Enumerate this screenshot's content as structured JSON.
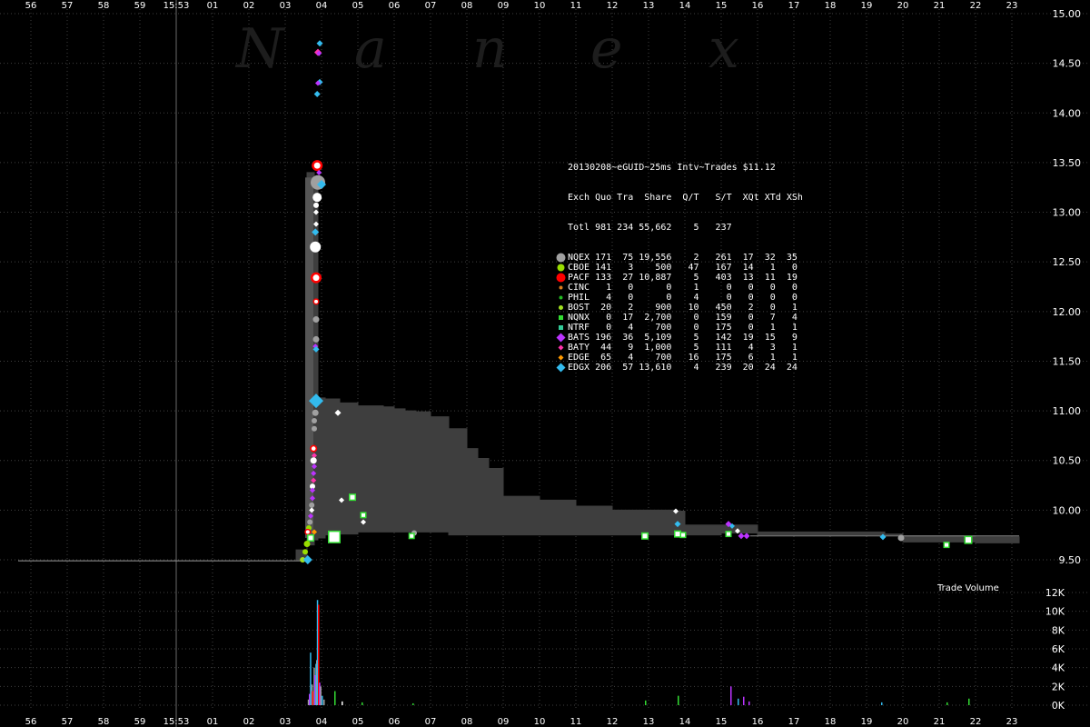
{
  "watermark": [
    "N",
    "a",
    "n",
    "e",
    "x"
  ],
  "x_ticks": [
    {
      "t": -4.0,
      "label": "56"
    },
    {
      "t": -3.0,
      "label": "57"
    },
    {
      "t": -2.0,
      "label": "58"
    },
    {
      "t": -1.0,
      "label": "59"
    },
    {
      "t": 0.0,
      "label": "15:53"
    },
    {
      "t": 1.0,
      "label": "01"
    },
    {
      "t": 2.0,
      "label": "02"
    },
    {
      "t": 3.0,
      "label": "03"
    },
    {
      "t": 4.0,
      "label": "04"
    },
    {
      "t": 5.0,
      "label": "05"
    },
    {
      "t": 6.0,
      "label": "06"
    },
    {
      "t": 7.0,
      "label": "07"
    },
    {
      "t": 8.0,
      "label": "08"
    },
    {
      "t": 9.0,
      "label": "09"
    },
    {
      "t": 10.0,
      "label": "10"
    },
    {
      "t": 11.0,
      "label": "11"
    },
    {
      "t": 12.0,
      "label": "12"
    },
    {
      "t": 13.0,
      "label": "13"
    },
    {
      "t": 14.0,
      "label": "14"
    },
    {
      "t": 15.0,
      "label": "15"
    },
    {
      "t": 16.0,
      "label": "16"
    },
    {
      "t": 17.0,
      "label": "17"
    },
    {
      "t": 18.0,
      "label": "18"
    },
    {
      "t": 19.0,
      "label": "19"
    },
    {
      "t": 20.0,
      "label": "20"
    },
    {
      "t": 21.0,
      "label": "21"
    },
    {
      "t": 22.0,
      "label": "22"
    },
    {
      "t": 23.0,
      "label": "23"
    }
  ],
  "volume_label": "Trade Volume",
  "legend": {
    "title": "20130208~eGUID~25ms Intv~Trades $11.12",
    "header": "Exch Quo Tra  Share  Q/T   S/T  XQt XTd XSh",
    "total": "Totl 981 234 55,662    5   237",
    "rows": [
      {
        "text": "NQEX 171  75 19,556    2   261  17  32  35",
        "color": "#a0a0a0",
        "shape": "circle",
        "size": 5
      },
      {
        "text": "CBOE 141   3    500   47   167  14   1   0",
        "color": "#99dd00",
        "shape": "circle",
        "size": 4
      },
      {
        "text": "PACF 133  27 10,887    5   403  13  11  19",
        "color": "#ff0000",
        "shape": "circle",
        "size": 5
      },
      {
        "text": "CINC   1   0      0    1     0   0   0   0",
        "color": "#d97c1c",
        "shape": "circle",
        "size": 2
      },
      {
        "text": "PHIL   4   0      0    4     0   0   0   0",
        "color": "#22bb22",
        "shape": "circle",
        "size": 2
      },
      {
        "text": "BOST  20   2    900   10   450   2   0   1",
        "color": "#a0e020",
        "shape": "circle",
        "size": 2.5
      },
      {
        "text": "NQNX   0  17  2,700    0   159   0   7   4",
        "color": "#33dd33",
        "shape": "square",
        "size": 2.5
      },
      {
        "text": "NTRF   0   4    700    0   175   0   1   1",
        "color": "#33cc99",
        "shape": "square",
        "size": 2.5
      },
      {
        "text": "BATS 196  36  5,109    5   142  19  15   9",
        "color": "#bb33ff",
        "shape": "diamond",
        "size": 5
      },
      {
        "text": "BATY  44   9  1,000    5   111   4   3   1",
        "color": "#ff33aa",
        "shape": "diamond",
        "size": 3
      },
      {
        "text": "EDGE  65   4    700   16   175   6   1   1",
        "color": "#ff9900",
        "shape": "diamond",
        "size": 3
      },
      {
        "text": "EDGX 206  57 13,610    4   239  20  24  24",
        "color": "#33bbee",
        "shape": "diamond",
        "size": 5
      }
    ]
  },
  "chart_data": {
    "type": "scatter",
    "x_unit": "seconds after 15:53:00 (axis also shows 15:52:56 onward)",
    "xlim": [
      -4.5,
      24.5
    ],
    "price_ylim": [
      9.45,
      15.0
    ],
    "price_ticks": [
      "9.50",
      "10.00",
      "10.50",
      "11.00",
      "11.50",
      "12.00",
      "12.50",
      "13.00",
      "13.50",
      "14.00",
      "14.50",
      "15.00"
    ],
    "volume_ylim": [
      0,
      12000
    ],
    "volume_ticks": [
      "0K",
      "2K",
      "4K",
      "6K",
      "8K",
      "10K",
      "12K"
    ],
    "pre_move_price": 9.49,
    "nbbo_band": [
      {
        "t": 3.3,
        "bid": 9.5,
        "ask": 9.6
      },
      {
        "t": 3.6,
        "bid": 9.65,
        "ask": 13.4
      },
      {
        "t": 3.8,
        "bid": 9.7,
        "ask": 13.3
      },
      {
        "t": 3.9,
        "bid": 9.72,
        "ask": 11.13
      },
      {
        "t": 4.1,
        "bid": 9.75,
        "ask": 11.12
      },
      {
        "t": 4.5,
        "bid": 9.76,
        "ask": 11.08
      },
      {
        "t": 5.0,
        "bid": 9.78,
        "ask": 11.05
      },
      {
        "t": 5.7,
        "bid": 9.78,
        "ask": 11.04
      },
      {
        "t": 6.0,
        "bid": 9.78,
        "ask": 11.02
      },
      {
        "t": 6.3,
        "bid": 9.78,
        "ask": 11.0
      },
      {
        "t": 6.6,
        "bid": 9.78,
        "ask": 10.99
      },
      {
        "t": 7.0,
        "bid": 9.78,
        "ask": 10.94
      },
      {
        "t": 7.5,
        "bid": 9.75,
        "ask": 10.82
      },
      {
        "t": 8.0,
        "bid": 9.75,
        "ask": 10.62
      },
      {
        "t": 8.3,
        "bid": 9.75,
        "ask": 10.52
      },
      {
        "t": 8.6,
        "bid": 9.75,
        "ask": 10.42
      },
      {
        "t": 9.0,
        "bid": 9.75,
        "ask": 10.14
      },
      {
        "t": 10.0,
        "bid": 9.75,
        "ask": 10.1
      },
      {
        "t": 11.0,
        "bid": 9.75,
        "ask": 10.04
      },
      {
        "t": 12.0,
        "bid": 9.75,
        "ask": 10.0
      },
      {
        "t": 13.8,
        "bid": 9.75,
        "ask": 9.99
      },
      {
        "t": 14.0,
        "bid": 9.75,
        "ask": 9.85
      },
      {
        "t": 15.0,
        "bid": 9.77,
        "ask": 9.85
      },
      {
        "t": 16.0,
        "bid": 9.75,
        "ask": 9.78
      },
      {
        "t": 19.5,
        "bid": 9.75,
        "ask": 9.76
      },
      {
        "t": 20.0,
        "bid": 9.68,
        "ask": 9.74
      },
      {
        "t": 22.0,
        "bid": 9.67,
        "ask": 9.73
      },
      {
        "t": 23.2,
        "bid": 9.67,
        "ask": 9.73
      }
    ],
    "quotes": [
      {
        "t": 3.95,
        "p": 14.7,
        "c": "#33bbee",
        "s": "diamond",
        "r": 3.5
      },
      {
        "t": 3.9,
        "p": 14.61,
        "c": "#ff33aa",
        "s": "diamond",
        "r": 4
      },
      {
        "t": 3.93,
        "p": 14.6,
        "c": "#bb33ff",
        "s": "diamond",
        "r": 3
      },
      {
        "t": 3.95,
        "p": 14.31,
        "c": "#33bbee",
        "s": "diamond",
        "r": 3.5
      },
      {
        "t": 3.9,
        "p": 14.3,
        "c": "#bb33ff",
        "s": "diamond",
        "r": 3
      },
      {
        "t": 3.88,
        "p": 14.19,
        "c": "#33bbee",
        "s": "diamond",
        "r": 3.5
      },
      {
        "t": 3.88,
        "p": 13.47,
        "c": "#ff0000",
        "s": "ring",
        "r": 6
      },
      {
        "t": 3.93,
        "p": 13.4,
        "c": "#bb33ff",
        "s": "diamond",
        "r": 3
      },
      {
        "t": 3.9,
        "p": 13.3,
        "c": "#a0a0a0",
        "s": "circle",
        "r": 8
      },
      {
        "t": 4.0,
        "p": 13.28,
        "c": "#33bbee",
        "s": "diamond",
        "r": 5
      },
      {
        "t": 3.88,
        "p": 13.15,
        "c": "#ffffff",
        "s": "circle",
        "r": 5
      },
      {
        "t": 3.85,
        "p": 13.07,
        "c": "#ffffff",
        "s": "circle",
        "r": 3
      },
      {
        "t": 3.85,
        "p": 13.0,
        "c": "#ffffff",
        "s": "diamond",
        "r": 3
      },
      {
        "t": 3.85,
        "p": 12.88,
        "c": "#ffffff",
        "s": "diamond",
        "r": 3
      },
      {
        "t": 3.83,
        "p": 12.8,
        "c": "#33bbee",
        "s": "diamond",
        "r": 4
      },
      {
        "t": 3.83,
        "p": 12.65,
        "c": "#ffffff",
        "s": "ring",
        "r": 6
      },
      {
        "t": 3.85,
        "p": 12.34,
        "c": "#ff0000",
        "s": "ring",
        "r": 6
      },
      {
        "t": 3.85,
        "p": 12.1,
        "c": "#ff0000",
        "s": "ring",
        "r": 3.5
      },
      {
        "t": 3.85,
        "p": 11.92,
        "c": "#a0a0a0",
        "s": "circle",
        "r": 3.5
      },
      {
        "t": 3.85,
        "p": 11.72,
        "c": "#a0a0a0",
        "s": "circle",
        "r": 3.5
      },
      {
        "t": 3.83,
        "p": 11.65,
        "c": "#bb33ff",
        "s": "diamond",
        "r": 3
      },
      {
        "t": 3.85,
        "p": 11.62,
        "c": "#33bbee",
        "s": "diamond",
        "r": 3.5
      },
      {
        "t": 3.85,
        "p": 11.1,
        "c": "#33bbee",
        "s": "diamond",
        "r": 8
      },
      {
        "t": 3.83,
        "p": 10.98,
        "c": "#a0a0a0",
        "s": "circle",
        "r": 3.5
      },
      {
        "t": 3.8,
        "p": 10.9,
        "c": "#a0a0a0",
        "s": "circle",
        "r": 3
      },
      {
        "t": 3.8,
        "p": 10.82,
        "c": "#a0a0a0",
        "s": "circle",
        "r": 3
      },
      {
        "t": 4.45,
        "p": 10.98,
        "c": "#ffffff",
        "s": "diamond",
        "r": 3.5
      },
      {
        "t": 3.78,
        "p": 10.62,
        "c": "#ff0000",
        "s": "ring",
        "r": 4
      },
      {
        "t": 3.8,
        "p": 10.55,
        "c": "#ff33aa",
        "s": "diamond",
        "r": 3
      },
      {
        "t": 3.78,
        "p": 10.5,
        "c": "#ffffff",
        "s": "circle",
        "r": 3.5
      },
      {
        "t": 3.8,
        "p": 10.44,
        "c": "#bb33ff",
        "s": "diamond",
        "r": 3
      },
      {
        "t": 3.78,
        "p": 10.37,
        "c": "#bb33ff",
        "s": "diamond",
        "r": 3
      },
      {
        "t": 3.78,
        "p": 10.3,
        "c": "#ff33aa",
        "s": "diamond",
        "r": 3
      },
      {
        "t": 3.75,
        "p": 10.24,
        "c": "#ffffff",
        "s": "circle",
        "r": 3
      },
      {
        "t": 3.75,
        "p": 10.2,
        "c": "#bb33ff",
        "s": "diamond",
        "r": 3
      },
      {
        "t": 3.75,
        "p": 10.12,
        "c": "#bb33ff",
        "s": "diamond",
        "r": 3
      },
      {
        "t": 3.73,
        "p": 10.05,
        "c": "#a0a0a0",
        "s": "circle",
        "r": 3
      },
      {
        "t": 3.73,
        "p": 10.0,
        "c": "#ffffff",
        "s": "diamond",
        "r": 3
      },
      {
        "t": 3.7,
        "p": 9.94,
        "c": "#bb33ff",
        "s": "diamond",
        "r": 3
      },
      {
        "t": 3.68,
        "p": 9.88,
        "c": "#a0a0a0",
        "s": "circle",
        "r": 3
      },
      {
        "t": 3.65,
        "p": 9.82,
        "c": "#99dd00",
        "s": "circle",
        "r": 3
      },
      {
        "t": 3.62,
        "p": 9.78,
        "c": "#ff0000",
        "s": "ring",
        "r": 3.5
      },
      {
        "t": 3.8,
        "p": 9.78,
        "c": "#ff9900",
        "s": "diamond",
        "r": 3
      },
      {
        "t": 3.7,
        "p": 9.72,
        "c": "#33dd33",
        "s": "square",
        "r": 4
      },
      {
        "t": 3.6,
        "p": 9.66,
        "c": "#99dd00",
        "s": "circle",
        "r": 3.5
      },
      {
        "t": 3.55,
        "p": 9.58,
        "c": "#99dd00",
        "s": "circle",
        "r": 3
      },
      {
        "t": 3.48,
        "p": 9.5,
        "c": "#a0e020",
        "s": "circle",
        "r": 3
      },
      {
        "t": 3.62,
        "p": 9.5,
        "c": "#33bbee",
        "s": "diamond",
        "r": 5
      },
      {
        "t": 4.35,
        "p": 9.73,
        "c": "#33dd33",
        "s": "square",
        "r": 7
      },
      {
        "t": 4.55,
        "p": 10.1,
        "c": "#ffffff",
        "s": "diamond",
        "r": 3
      },
      {
        "t": 4.85,
        "p": 10.13,
        "c": "#33dd33",
        "s": "square",
        "r": 4
      },
      {
        "t": 5.15,
        "p": 9.95,
        "c": "#33dd33",
        "s": "square",
        "r": 3.5
      },
      {
        "t": 5.15,
        "p": 9.88,
        "c": "#ffffff",
        "s": "diamond",
        "r": 3
      },
      {
        "t": 6.55,
        "p": 9.77,
        "c": "#a0a0a0",
        "s": "circle",
        "r": 3
      },
      {
        "t": 6.48,
        "p": 9.74,
        "c": "#33dd33",
        "s": "square",
        "r": 3.5
      },
      {
        "t": 12.9,
        "p": 9.74,
        "c": "#33dd33",
        "s": "square",
        "r": 4
      },
      {
        "t": 13.75,
        "p": 9.99,
        "c": "#ffffff",
        "s": "diamond",
        "r": 3
      },
      {
        "t": 13.8,
        "p": 9.86,
        "c": "#33bbee",
        "s": "diamond",
        "r": 3.5
      },
      {
        "t": 13.8,
        "p": 9.76,
        "c": "#33dd33",
        "s": "square",
        "r": 4
      },
      {
        "t": 13.95,
        "p": 9.75,
        "c": "#33dd33",
        "s": "square",
        "r": 3.5
      },
      {
        "t": 15.2,
        "p": 9.86,
        "c": "#bb33ff",
        "s": "diamond",
        "r": 3.5
      },
      {
        "t": 15.3,
        "p": 9.84,
        "c": "#33bbee",
        "s": "diamond",
        "r": 3
      },
      {
        "t": 15.45,
        "p": 9.79,
        "c": "#ffffff",
        "s": "diamond",
        "r": 3
      },
      {
        "t": 15.2,
        "p": 9.76,
        "c": "#33dd33",
        "s": "square",
        "r": 3.5
      },
      {
        "t": 15.55,
        "p": 9.74,
        "c": "#bb33ff",
        "s": "diamond",
        "r": 3.5
      },
      {
        "t": 15.7,
        "p": 9.74,
        "c": "#bb33ff",
        "s": "diamond",
        "r": 3.5
      },
      {
        "t": 19.45,
        "p": 9.73,
        "c": "#33bbee",
        "s": "diamond",
        "r": 3.5
      },
      {
        "t": 19.95,
        "p": 9.72,
        "c": "#a0a0a0",
        "s": "circle",
        "r": 3.5
      },
      {
        "t": 21.2,
        "p": 9.65,
        "c": "#33dd33",
        "s": "square",
        "r": 3.5
      },
      {
        "t": 21.8,
        "p": 9.7,
        "c": "#33dd33",
        "s": "square",
        "r": 4.5
      }
    ],
    "volume_bars": [
      {
        "t": 3.62,
        "v": 600,
        "c": "#a0a0a0"
      },
      {
        "t": 3.65,
        "v": 1200,
        "c": "#bb33ff"
      },
      {
        "t": 3.68,
        "v": 5600,
        "c": "#33bbee"
      },
      {
        "t": 3.72,
        "v": 2200,
        "c": "#a0a0a0"
      },
      {
        "t": 3.74,
        "v": 1500,
        "c": "#ff0000"
      },
      {
        "t": 3.78,
        "v": 4000,
        "c": "#a0a0a0"
      },
      {
        "t": 3.8,
        "v": 3200,
        "c": "#bb33ff"
      },
      {
        "t": 3.83,
        "v": 4400,
        "c": "#33bbee"
      },
      {
        "t": 3.85,
        "v": 4800,
        "c": "#a0a0a0"
      },
      {
        "t": 3.87,
        "v": 11200,
        "c": "#33bbee"
      },
      {
        "t": 3.9,
        "v": 10700,
        "c": "#ff0000"
      },
      {
        "t": 3.93,
        "v": 2400,
        "c": "#bb33ff"
      },
      {
        "t": 3.96,
        "v": 2000,
        "c": "#a0a0a0"
      },
      {
        "t": 4.0,
        "v": 1000,
        "c": "#33bbee"
      },
      {
        "t": 4.05,
        "v": 600,
        "c": "#a0a0a0"
      },
      {
        "t": 4.35,
        "v": 1500,
        "c": "#33dd33"
      },
      {
        "t": 4.55,
        "v": 400,
        "c": "#ffffff"
      },
      {
        "t": 5.1,
        "v": 300,
        "c": "#33dd33"
      },
      {
        "t": 6.5,
        "v": 200,
        "c": "#33dd33"
      },
      {
        "t": 12.9,
        "v": 500,
        "c": "#33dd33"
      },
      {
        "t": 13.8,
        "v": 1000,
        "c": "#33dd33"
      },
      {
        "t": 15.25,
        "v": 2000,
        "c": "#bb33ff"
      },
      {
        "t": 15.45,
        "v": 700,
        "c": "#33bbee"
      },
      {
        "t": 15.6,
        "v": 900,
        "c": "#bb33ff"
      },
      {
        "t": 15.75,
        "v": 400,
        "c": "#bb33ff"
      },
      {
        "t": 19.4,
        "v": 300,
        "c": "#33bbee"
      },
      {
        "t": 21.2,
        "v": 300,
        "c": "#33dd33"
      },
      {
        "t": 21.8,
        "v": 700,
        "c": "#33dd33"
      }
    ]
  }
}
